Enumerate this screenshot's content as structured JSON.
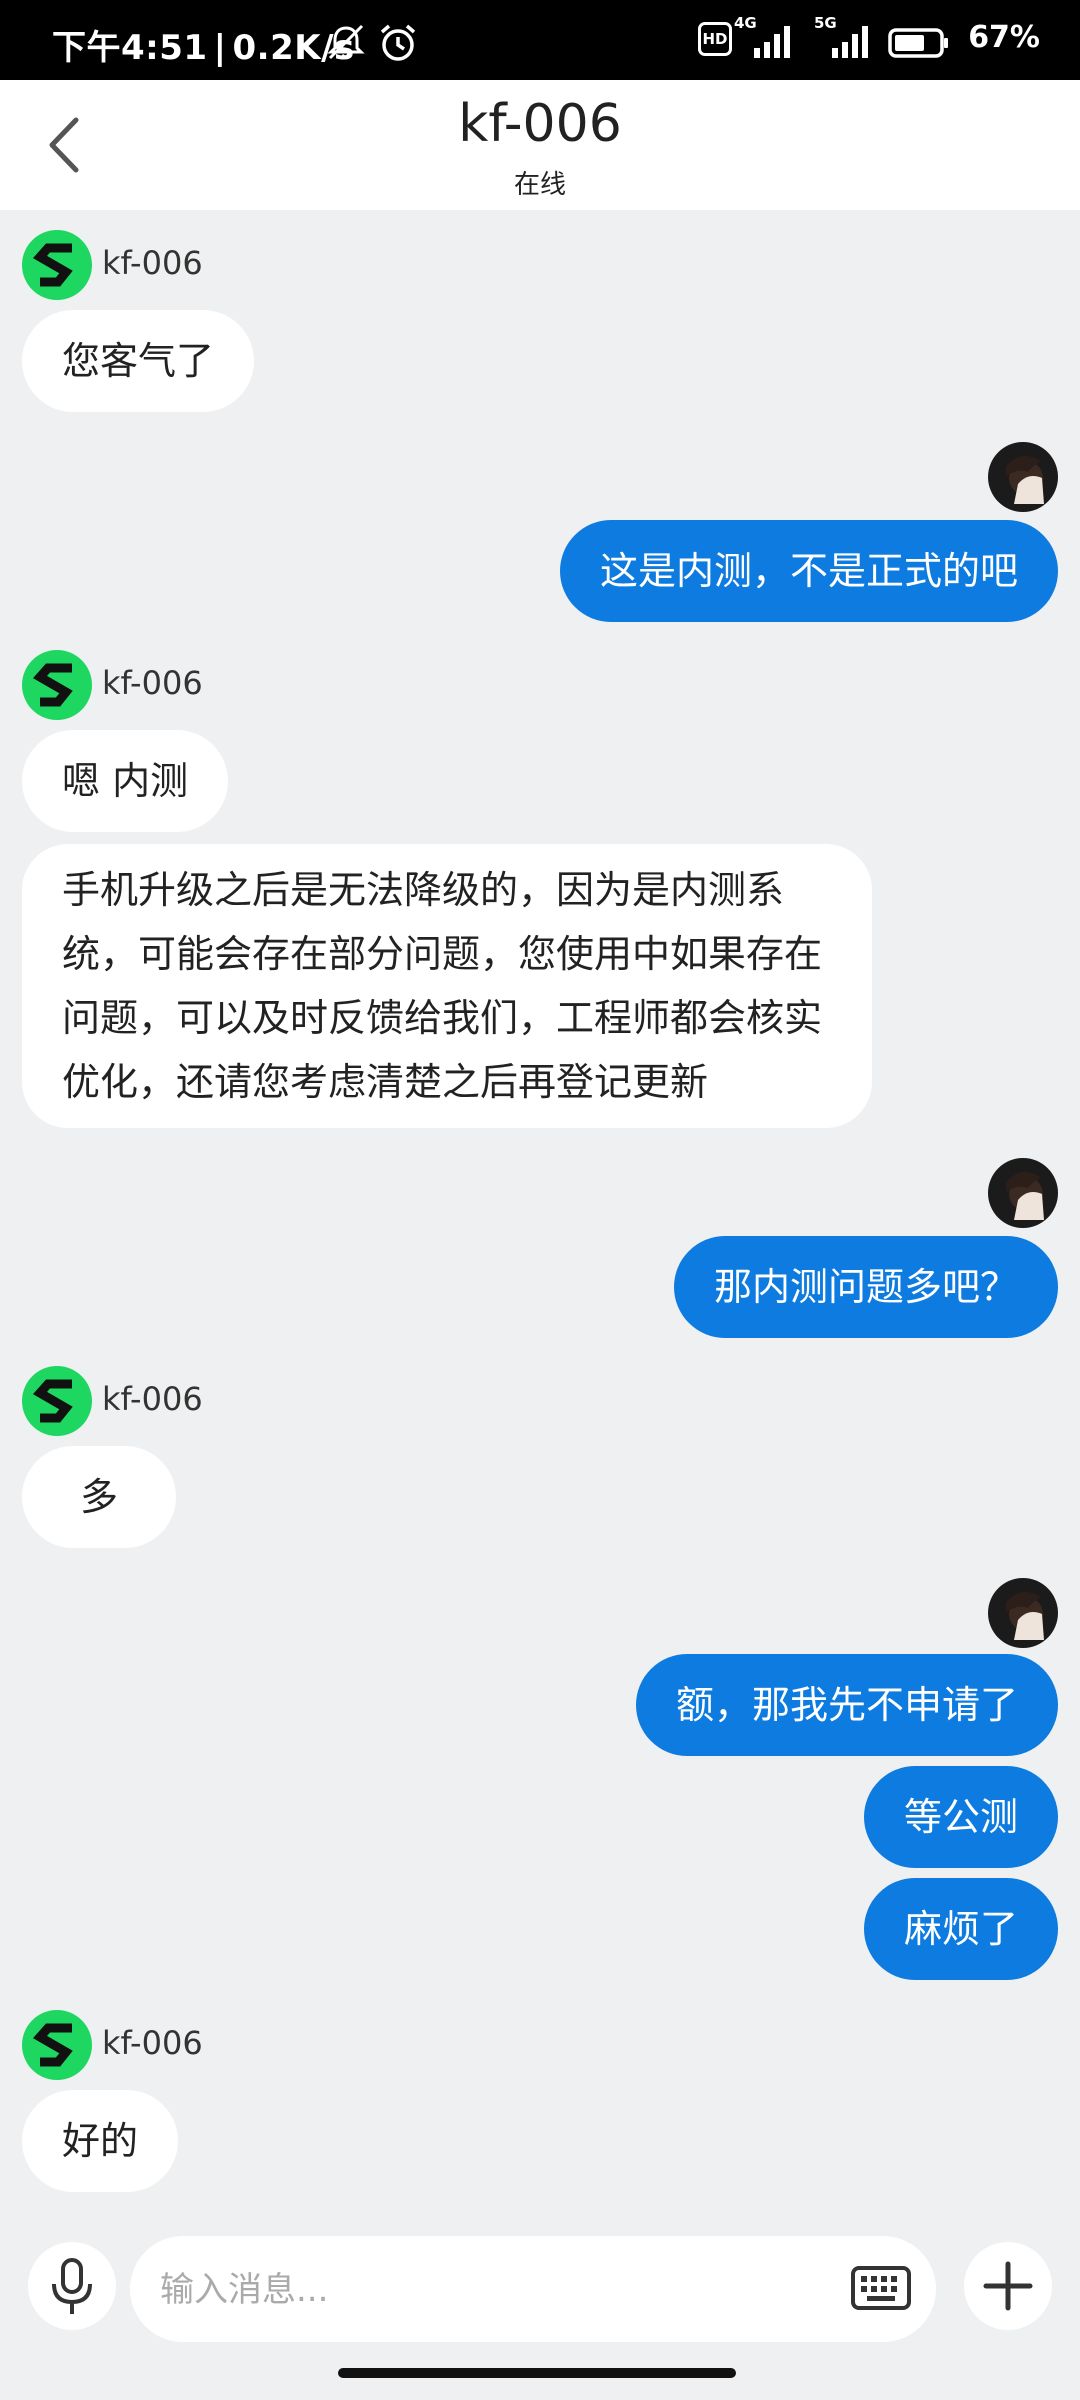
{
  "status_bar": {
    "time": "下午4:51",
    "net_speed": "0.2K/s",
    "battery": "67%",
    "net_4g": "4G",
    "net_5g": "5G",
    "hd": "HD"
  },
  "header": {
    "title": "kf-006",
    "subtitle": "在线"
  },
  "agent": {
    "name": "kf-006"
  },
  "messages": {
    "m1": "您客气了",
    "m2": "这是内测，不是正式的吧",
    "m3": "嗯 内测",
    "m4": "手机升级之后是无法降级的，因为是内测系统，可能会存在部分问题，您使用中如果存在问题，可以及时反馈给我们，工程师都会核实优化，还请您考虑清楚之后再登记更新",
    "m5": "那内测问题多吧？",
    "m6": "多",
    "m7": "额，那我先不申请了",
    "m8": "等公测",
    "m9": "麻烦了",
    "m10": "好的"
  },
  "input": {
    "placeholder": "输入消息..."
  },
  "colors": {
    "accent": "#0d7be0",
    "agent_avatar": "#1ed760",
    "background": "#eff0f1"
  },
  "icons": [
    "back-icon",
    "mic-icon",
    "keyboard-icon",
    "plus-icon",
    "silent-bell-icon",
    "alarm-icon",
    "signal-icon",
    "battery-icon"
  ]
}
